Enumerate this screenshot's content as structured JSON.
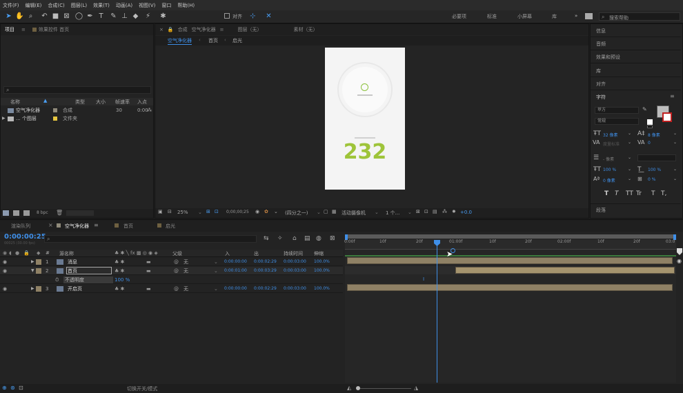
{
  "menubar": {
    "items": [
      "文件(F)",
      "编辑(E)",
      "合成(C)",
      "图层(L)",
      "效果(T)",
      "动画(A)",
      "视图(V)",
      "窗口",
      "帮助(H)"
    ]
  },
  "toolbar": {
    "snap_label": "对齐",
    "workspaces": [
      "必要项",
      "标准",
      "小屏幕",
      "库"
    ],
    "search_placeholder": "搜索帮助"
  },
  "project_panel": {
    "tab": "项目",
    "tab2": "效果控件 首页",
    "columns": [
      "名称",
      "类型",
      "大小",
      "帧速率",
      "入点"
    ],
    "items": [
      {
        "name": "空气净化器",
        "type": "合成",
        "fps": "30",
        "in": "0:00"
      },
      {
        "name": "... 个图层",
        "type": "文件夹",
        "fps": "",
        "in": ""
      }
    ],
    "bpc": "8 bpc"
  },
  "composition_panel": {
    "header_prefix": "合成",
    "title": "空气净化器",
    "layer_tab": "图层（无）",
    "footage_tab": "素材（无）",
    "breadcrumbs": [
      "空气净化器",
      "首页",
      "启光"
    ],
    "preview": {
      "value": "232"
    },
    "footer": {
      "zoom": "25%",
      "time": "0;00;00;25",
      "resolution": "(四分之一)",
      "camera": "活动摄像机",
      "views": "1 个...",
      "exposure": "+0.0"
    }
  },
  "right_panel": {
    "items": [
      "信息",
      "音频",
      "效果和预设",
      "库",
      "对齐",
      "字符"
    ],
    "character": {
      "font": "苹方",
      "style": "常规",
      "size": "32 像素",
      "leading": "8 像素",
      "tracking_label": "度量标准",
      "tracking_val": "0",
      "indent": "- 像素",
      "vscale": "100 %",
      "hscale": "100 %",
      "baseline": "0 像素",
      "tsume": "0 %",
      "styles": [
        "T",
        "T",
        "TT",
        "Tr",
        "T",
        "T,"
      ]
    },
    "paragraph": "段落"
  },
  "timeline": {
    "tabs": [
      {
        "label": "渲染队列",
        "active": false
      },
      {
        "label": "空气净化器",
        "active": true
      },
      {
        "label": "首页",
        "active": false
      },
      {
        "label": "启光",
        "active": false
      }
    ],
    "timecode": "0:00:00:25",
    "frame_info": "00025 (30.00 fps)",
    "columns": [
      "#",
      "源名称",
      "父级",
      "入",
      "出",
      "持续时间",
      "伸缩"
    ],
    "layers": [
      {
        "num": "1",
        "name": "消息",
        "parent": "无",
        "in": "0:00:00:00",
        "out": "0:00:02:29",
        "dur": "0:00:03:00",
        "stretch": "100.0%"
      },
      {
        "num": "2",
        "name": "首页",
        "parent": "无",
        "in": "0:00:01:00",
        "out": "0:00:03:29",
        "dur": "0:00:03:00",
        "stretch": "100.0%"
      },
      {
        "num": "3",
        "name": "开启页",
        "parent": "无",
        "in": "0:00:00:00",
        "out": "0:00:02:29",
        "dur": "0:00:03:00",
        "stretch": "100.0%"
      }
    ],
    "property": {
      "name": "不透明度",
      "value": "100 %"
    },
    "ruler": [
      "0:00f",
      "10f",
      "20f",
      "01:00f",
      "10f",
      "20f",
      "02:00f",
      "10f",
      "20f",
      "03:0"
    ],
    "footer": "切换开关/模式"
  }
}
